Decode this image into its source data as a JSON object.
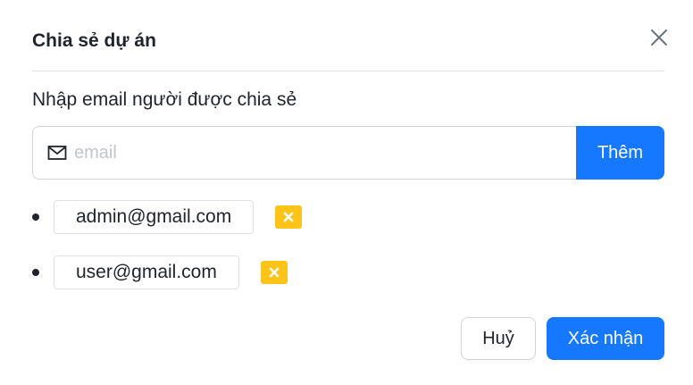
{
  "dialog": {
    "title": "Chia sẻ dự án",
    "prompt": "Nhập email người được chia sẻ"
  },
  "email_input": {
    "placeholder": "email",
    "value": "",
    "icon": "mail-icon"
  },
  "add_button": {
    "label": "Thêm"
  },
  "shared_emails": [
    {
      "email": "admin@gmail.com",
      "remove_icon": "close-icon"
    },
    {
      "email": "user@gmail.com",
      "remove_icon": "close-icon"
    }
  ],
  "footer": {
    "cancel_label": "Huỷ",
    "confirm_label": "Xác nhận"
  },
  "colors": {
    "primary": "#1677ff",
    "remove": "#fcc419",
    "border": "#dee2e6"
  }
}
